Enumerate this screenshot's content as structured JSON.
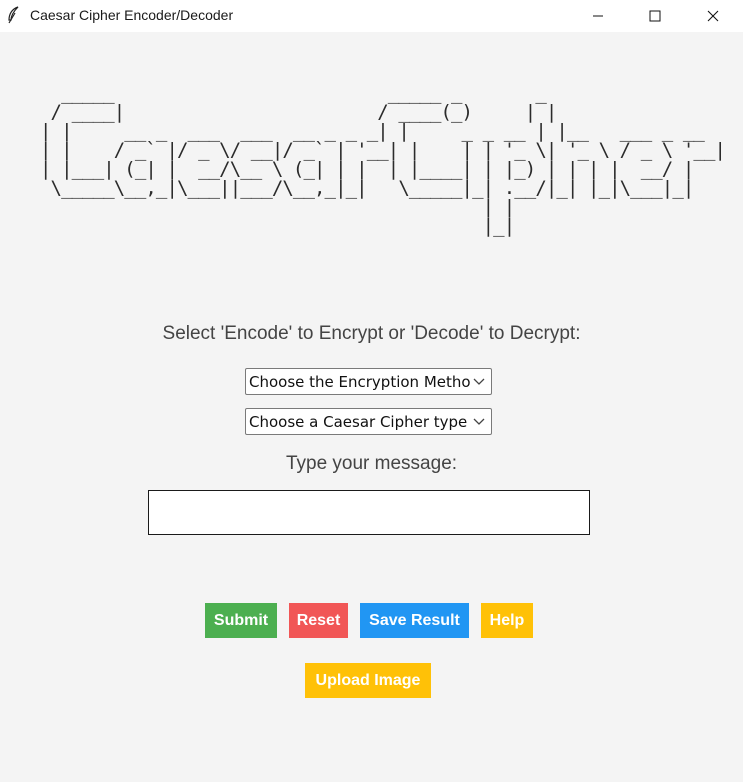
{
  "window": {
    "title": "Caesar Cipher Encoder/Decoder",
    "icon": "feather-icon",
    "controls": [
      "minimize-icon",
      "maximize-icon",
      "close-icon"
    ]
  },
  "banner": {
    "ascii_art": "  _____                          _____ _       _               \n / ____|                        / ____(_)     | |              \n| |     __ _  ___  ___  __ _ _ _| |     _ _ __ | |__   ___ _ __ \n| |    / _` |/ _ \\/ __|/ _` | '__| |    | | '_ \\| '_ \\ / _ \\ '__|\n| |___| (_| |  __/\\__ \\ (_| | |  | |____| | |_) | | | |  __/ |   \n \\_____\\__,_|\\___||___/\\__,_|_|   \\_____|_| .__/|_| |_|\\___|_|   \n                                          | |                    \n                                          |_|                    "
  },
  "mode_prompt": "Select 'Encode' to Encrypt or 'Decode' to Decrypt:",
  "method_select": {
    "value": "Choose the Encryption Method"
  },
  "type_select": {
    "value": "Choose a Caesar Cipher type"
  },
  "message_prompt": "Type your message:",
  "message_input": {
    "value": ""
  },
  "buttons": {
    "submit": "Submit",
    "reset": "Reset",
    "save": "Save Result",
    "help": "Help",
    "upload": "Upload Image"
  },
  "colors": {
    "submit": "#4caf50",
    "reset": "#f15656",
    "save": "#2196f3",
    "help": "#ffc107",
    "upload": "#ffc107",
    "background": "#f4f4f4"
  }
}
